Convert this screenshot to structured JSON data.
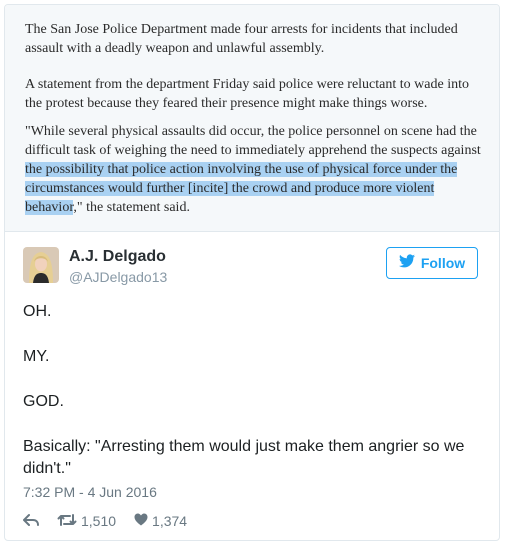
{
  "article": {
    "para1": "The San Jose Police Department made four arrests for incidents that included assault with a deadly weapon and unlawful assembly.",
    "para2": "A statement from the department Friday said police were reluctant to wade into the protest because they feared their presence might make things worse.",
    "para3_before": "\"While several physical assaults did occur, the police personnel on scene had the difficult task of weighing the need to immediately apprehend the suspects against ",
    "para3_highlight": "the possibility that police action involving the use of physical force under the circumstances would further [incite] the crowd and produce more violent behavior",
    "para3_after": ",\" the statement said."
  },
  "tweet": {
    "author_name": "A.J. Delgado",
    "author_handle": "@AJDelgado13",
    "follow_label": "Follow",
    "lines": [
      "OH.",
      "MY.",
      "GOD.",
      "Basically: \"Arresting them would just make them angrier so we didn't.\""
    ],
    "timestamp": "7:32 PM - 4 Jun 2016",
    "retweets": "1,510",
    "likes": "1,374"
  },
  "colors": {
    "accent": "#1da1f2",
    "highlight": "#a9d1f2",
    "muted": "#697882"
  },
  "icons": {
    "follow": "twitter-bird-icon",
    "reply": "reply-icon",
    "retweet": "retweet-icon",
    "like": "heart-icon"
  }
}
